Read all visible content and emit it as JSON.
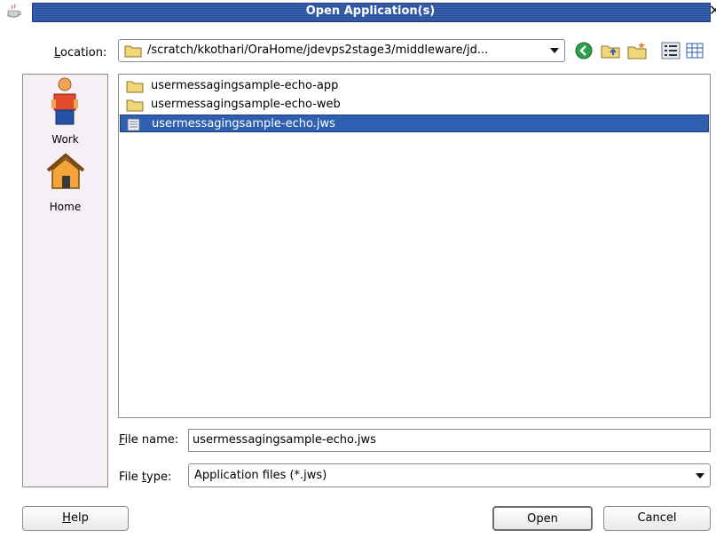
{
  "window": {
    "title": "Open Application(s)",
    "close_glyph": "✕",
    "app_icon": "java-cup-icon"
  },
  "location": {
    "label_mnemonic": "L",
    "label_rest": "ocation:",
    "path": "/scratch/kkothari/OraHome/jdevps2stage3/middleware/jd...",
    "icon": "folder-icon"
  },
  "toolbar": {
    "items": [
      "go-back-icon",
      "up-folder-icon",
      "new-folder-icon",
      "list-view-icon",
      "details-view-icon"
    ]
  },
  "places": [
    {
      "label": "Work",
      "icon": "user-work-icon"
    },
    {
      "label": "Home",
      "icon": "home-icon"
    }
  ],
  "files": [
    {
      "name": "usermessagingsample-echo-app",
      "icon": "folder-icon",
      "selected": false
    },
    {
      "name": "usermessagingsample-echo-web",
      "icon": "folder-icon",
      "selected": false
    },
    {
      "name": "usermessagingsample-echo.jws",
      "icon": "document-icon",
      "selected": true
    }
  ],
  "file_name": {
    "label_mnemonic": "F",
    "label_rest": "ile name:",
    "value": "usermessagingsample-echo.jws"
  },
  "file_type": {
    "label_pre": "File ",
    "label_mnemonic": "t",
    "label_rest": "ype:",
    "value": "Application files (*.jws)"
  },
  "buttons": {
    "help_mnemonic": "H",
    "help_rest": "elp",
    "open": "Open",
    "cancel": "Cancel"
  },
  "colors": {
    "title_bar": "#2d4f98",
    "selection": "#2f5fb0",
    "places_bg": "#f6eff6"
  }
}
